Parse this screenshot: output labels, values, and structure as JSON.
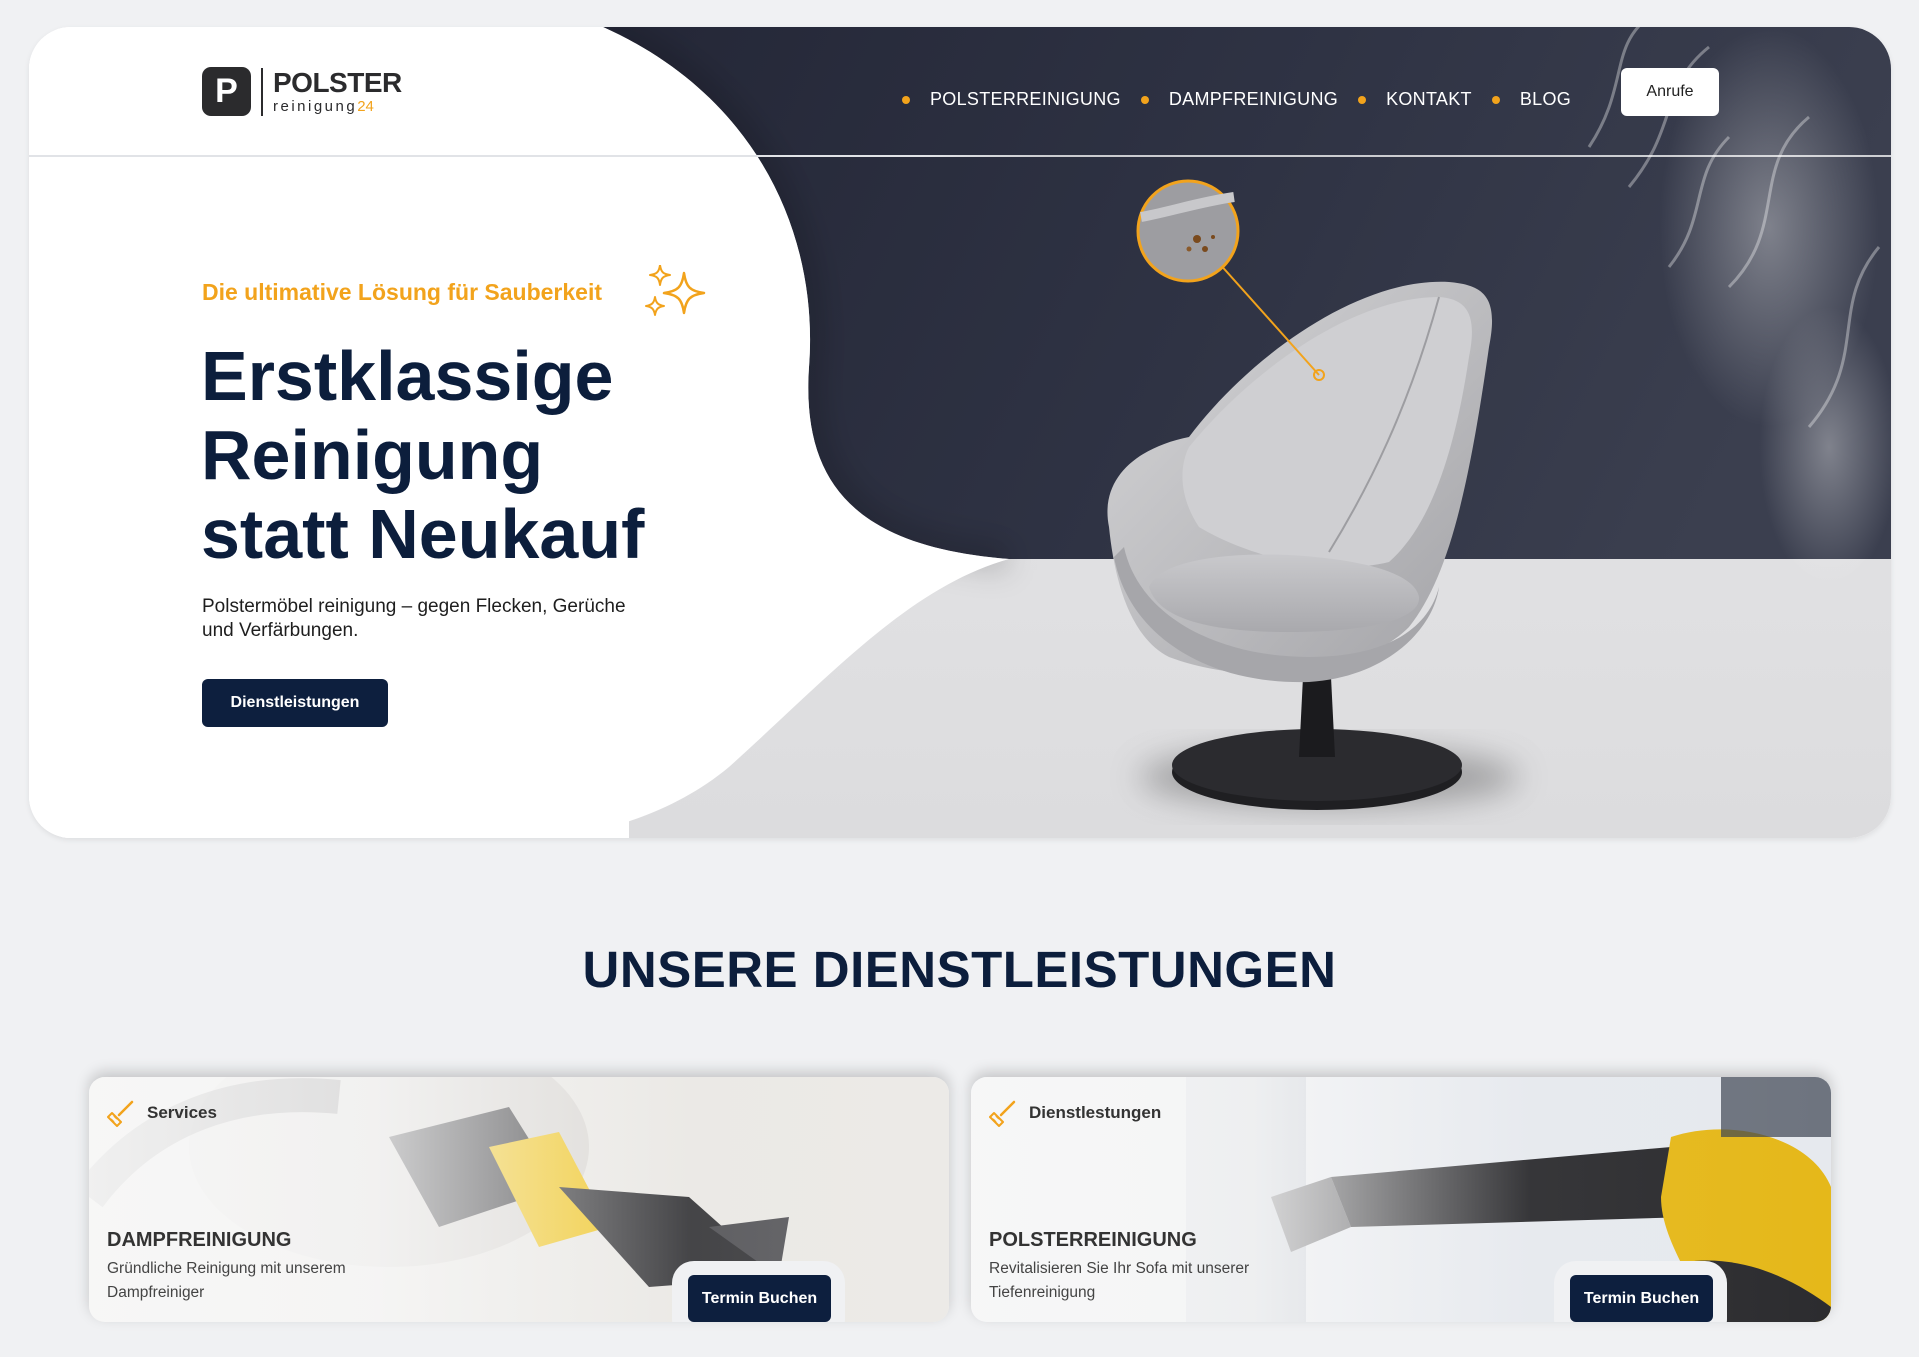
{
  "brand": {
    "logo_letter": "P",
    "name": "POLSTER",
    "sub": "reinigung",
    "sub_num": "24"
  },
  "nav": {
    "items": [
      {
        "label": "POLSTERREINIGUNG"
      },
      {
        "label": "DAMPFREINIGUNG"
      },
      {
        "label": "KONTAKT"
      },
      {
        "label": "BLOG"
      }
    ],
    "call_label": "Anrufe"
  },
  "hero": {
    "tagline": "Die ultimative Lösung für Sauberkeit",
    "headline_lines": [
      "Erstklassige",
      "Reinigung",
      "statt Neukauf"
    ],
    "subtext": "Polstermöbel reinigung – gegen Flecken, Gerüche und Verfärbungen.",
    "cta_label": "Dienstleistungen"
  },
  "services": {
    "title": "UNSERE DIENSTLEISTUNGEN",
    "cards": [
      {
        "tag": "Services",
        "title": "DAMPFREINIGUNG",
        "desc": "Gründliche Reinigung mit unserem Dampfreiniger",
        "button": "Termin Buchen"
      },
      {
        "tag": "Dienstlestungen",
        "title": "POLSTERREINIGUNG",
        "desc": "Revitalisieren Sie Ihr Sofa mit unserer Tiefenreinigung",
        "button": "Termin Buchen"
      }
    ]
  },
  "colors": {
    "navy": "#0c1e3c",
    "accent": "#f2a31c",
    "dark_panel": "#2e3142",
    "background": "#f0f1f3"
  }
}
